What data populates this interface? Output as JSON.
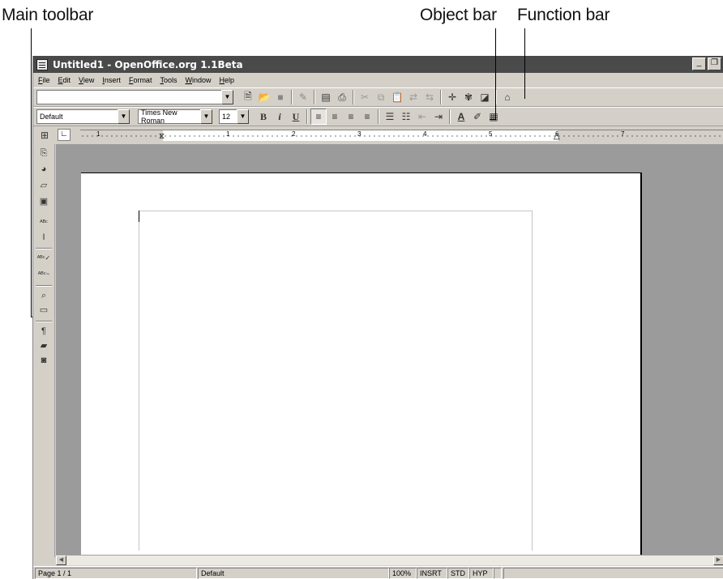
{
  "callouts": {
    "main_toolbar": "Main toolbar",
    "object_bar": "Object bar",
    "function_bar": "Function bar"
  },
  "window": {
    "title": "Untitled1 - OpenOffice.org 1.1Beta",
    "controls": {
      "minimize": "_",
      "restore": "❐",
      "close": "✕"
    }
  },
  "menu": [
    "File",
    "Edit",
    "View",
    "Insert",
    "Format",
    "Tools",
    "Window",
    "Help"
  ],
  "function_bar": {
    "url_value": "",
    "buttons": [
      "edit-file-icon",
      "open-icon",
      "save-icon",
      "edit-doc-icon",
      "export-pdf-icon",
      "print-icon",
      "cut-icon",
      "copy-icon",
      "paste-icon",
      "undo-icon",
      "redo-icon",
      "navigator-icon",
      "stylist-icon",
      "gallery-icon",
      "data-sources-icon"
    ]
  },
  "object_bar": {
    "paragraph_style": "Default",
    "font_name": "Times New Roman",
    "font_size": "12",
    "bold": "B",
    "italic": "i",
    "underline": "U",
    "align_left_active": true
  },
  "ruler": {
    "numbers": [
      "1",
      "1",
      "2",
      "3",
      "4",
      "5",
      "6",
      "7"
    ]
  },
  "statusbar": {
    "page": "Page 1 / 1",
    "style": "Default",
    "zoom": "100%",
    "insert_mode": "INSRT",
    "selection_mode": "STD",
    "hyperlink_mode": "HYP"
  },
  "colors": {
    "chrome": "#d4d0c8",
    "titlebar": "#4a4a4a",
    "workspace": "#9b9b9b"
  }
}
